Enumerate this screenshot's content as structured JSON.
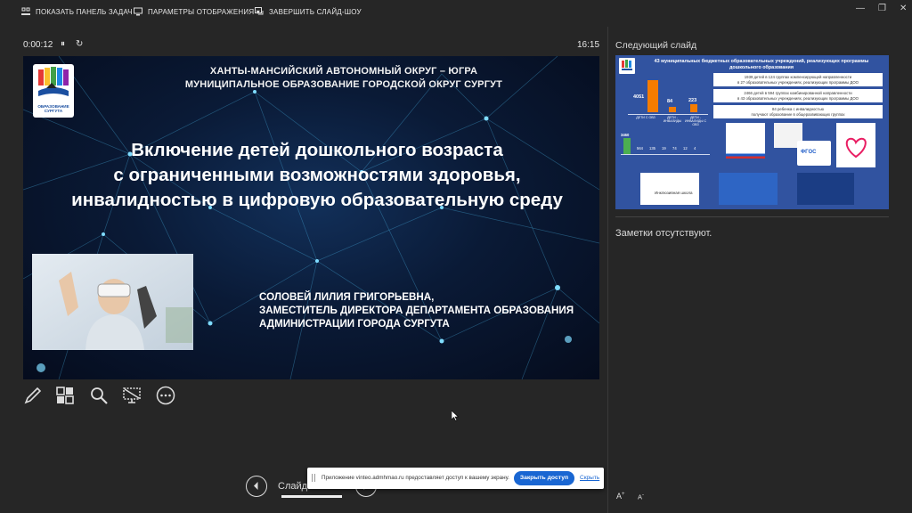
{
  "toolbar": {
    "show_taskbar": "ПОКАЗАТЬ ПАНЕЛЬ ЗАДАЧ",
    "display_settings": "ПАРАМЕТРЫ ОТОБРАЖЕНИЯ ▾",
    "end_show": "ЗАВЕРШИТЬ СЛАЙД-ШОУ"
  },
  "timer": {
    "elapsed": "0:00:12",
    "clock": "16:15"
  },
  "slide": {
    "logo_caption": "ОБРАЗОВАНИЕ СУРГУТА",
    "header_line1": "ХАНТЫ-МАНСИЙСКИЙ АВТОНОМНЫЙ ОКРУГ – ЮГРА",
    "header_line2": "МУНИЦИПАЛЬНОЕ ОБРАЗОВАНИЕ ГОРОДСКОЙ ОКРУГ СУРГУТ",
    "title_line1": "Включение детей дошкольного возраста",
    "title_line2": "с ограниченными возможностями здоровья,",
    "title_line3": "инвалидностью в цифровую образовательную среду",
    "author_line1": "СОЛОВЕЙ ЛИЛИЯ ГРИГОРЬЕВНА,",
    "author_line2": "ЗАМЕСТИТЕЛЬ ДИРЕКТОРА ДЕПАРТАМЕНТА ОБРАЗОВАНИЯ",
    "author_line3": "АДМИНИСТРАЦИИ ГОРОДА СУРГУТА"
  },
  "next_slide": {
    "label": "Следующий слайд",
    "title_line1": "43 муниципальных бюджетных образовательных учреждений, реализующих программы",
    "title_line2": "дошкольного образования",
    "bars": [
      {
        "value": "4051",
        "label": "ДЕТИ С ОВЗ",
        "h": 30
      },
      {
        "value": "84",
        "label": "ДЕТИ - ИНВАЛИДЫ",
        "h": 5
      },
      {
        "value": "223",
        "label": "ДЕТИ - ИНВАЛИДЫ С ОВЗ",
        "h": 9
      }
    ],
    "info1_line1": "1939 детей в 124 группах компенсирующей направленности",
    "info1_line2": "в 27 образовательных учреждениях, реализующих программы ДОО",
    "info2_line1": "2466 детей в 594 группах комбинированной направленности",
    "info2_line2": "в 43 образовательных учреждениях, реализующих программы ДОО",
    "info3_line1": "84 ребенка с инвалидностью",
    "info3_line2": "получают образование в общеразвивающих группах",
    "small_values": [
      "3460",
      "564",
      "135",
      "19",
      "74",
      "12",
      "4"
    ],
    "badge_text": "ФГОС",
    "card_text": "Инклюзивная школа"
  },
  "notes": {
    "text": "Заметки отсутствуют."
  },
  "font": {
    "increase": "A",
    "decrease": "A"
  },
  "bottom": {
    "slide_label": "Слайд"
  },
  "toast": {
    "message": "Приложение vinteo.admhmao.ru предоставляет доступ к вашему экрану.",
    "button": "Закрыть доступ",
    "hide": "Скрыть"
  }
}
